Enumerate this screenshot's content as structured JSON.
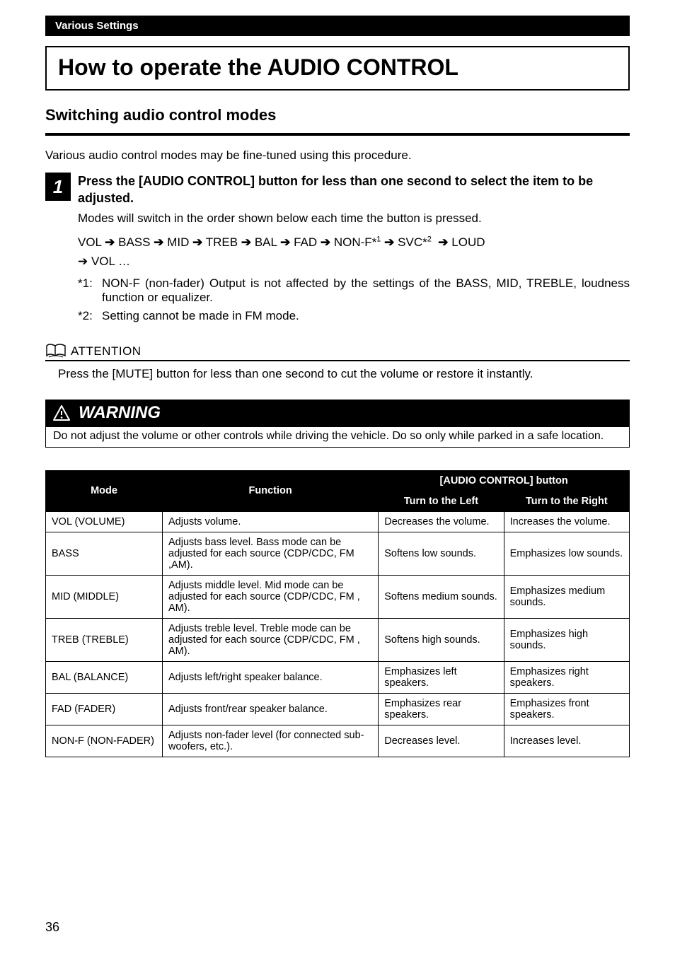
{
  "header_band": "Various Settings",
  "title": "How to operate the AUDIO CONTROL",
  "subtitle": "Switching audio control modes",
  "intro": "Various audio control modes may be fine-tuned using this procedure.",
  "step": {
    "num": "1",
    "title": "Press the [AUDIO CONTROL] button for less than one second to select the item to be adjusted.",
    "text": "Modes will switch in the order shown below each time the button is pressed."
  },
  "sequence": {
    "items": [
      "VOL",
      "BASS",
      "MID",
      "TREB",
      "BAL",
      "FAD",
      "NON-F*",
      "SVC*",
      "LOUD"
    ],
    "sup_nonf": "1",
    "sup_svc": "2",
    "wrap_prefix": "➔ VOL …"
  },
  "notes": [
    {
      "tag": "*1:",
      "txt": "NON-F (non-fader) Output is not affected by the settings of the BASS, MID, TREBLE, loudness function or equalizer."
    },
    {
      "tag": "*2:",
      "txt": "Setting cannot be made in FM mode."
    }
  ],
  "attention": {
    "label": "ATTENTION",
    "text": "Press the [MUTE] button for less than one second to cut the volume or restore it instantly."
  },
  "warning": {
    "label": "WARNING",
    "text": "Do not adjust the volume or other controls while driving the vehicle. Do so only while parked in a safe location."
  },
  "table": {
    "head_mode": "Mode",
    "head_function": "Function",
    "head_group": "[AUDIO CONTROL] button",
    "head_left": "Turn to the Left",
    "head_right": "Turn to the Right",
    "rows": [
      {
        "mode": "VOL (VOLUME)",
        "func": "Adjusts volume.",
        "left": "Decreases the volume.",
        "right": "Increases the volume."
      },
      {
        "mode": "BASS",
        "func": "Adjusts bass level. Bass mode can be adjusted for each source (CDP/CDC, FM ,AM).",
        "left": "Softens low sounds.",
        "right": "Emphasizes low sounds."
      },
      {
        "mode": "MID (MIDDLE)",
        "func": "Adjusts middle level. Mid mode can be adjusted for each source (CDP/CDC, FM , AM).",
        "left": "Softens medium sounds.",
        "right": "Emphasizes medium sounds."
      },
      {
        "mode": "TREB (TREBLE)",
        "func": "Adjusts treble level. Treble mode can be adjusted for each source (CDP/CDC, FM , AM).",
        "left": "Softens high sounds.",
        "right": "Emphasizes high sounds."
      },
      {
        "mode": "BAL (BALANCE)",
        "func": "Adjusts left/right speaker balance.",
        "left": "Emphasizes left speakers.",
        "right": "Emphasizes right speakers."
      },
      {
        "mode": "FAD (FADER)",
        "func": "Adjusts front/rear speaker balance.",
        "left": "Emphasizes rear speakers.",
        "right": "Emphasizes front speakers."
      },
      {
        "mode": "NON-F (NON-FADER)",
        "func": "Adjusts non-fader level (for connected sub-woofers, etc.).",
        "left": "Decreases level.",
        "right": "Increases level."
      }
    ]
  },
  "page_number": "36"
}
